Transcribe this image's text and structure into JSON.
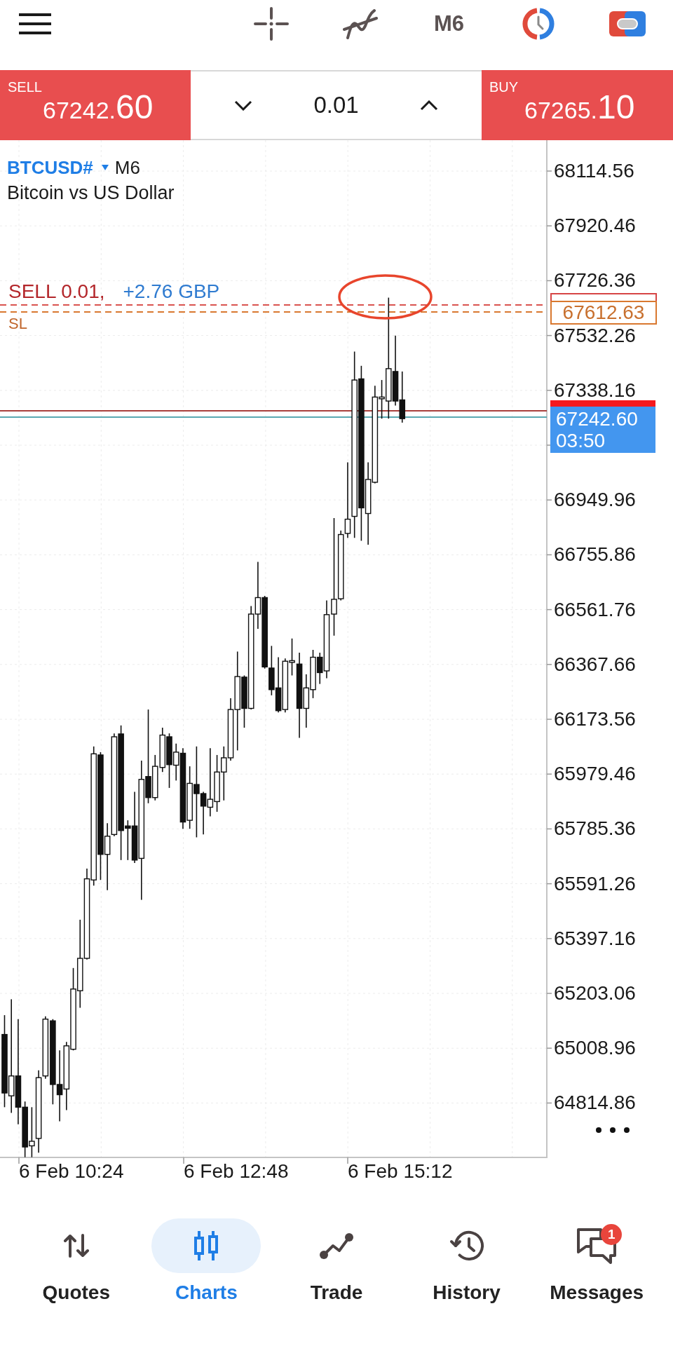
{
  "toolbar": {
    "timeframe": "M6"
  },
  "trade_panel": {
    "sell": {
      "label": "SELL",
      "price_head": "67242.",
      "price_tail": "60"
    },
    "volume": "0.01",
    "buy": {
      "label": "BUY",
      "price_head": "67265.",
      "price_tail": "10"
    }
  },
  "chart": {
    "symbol": "BTCUSD#",
    "timeframe": "M6",
    "description": "Bitcoin vs US Dollar",
    "position": {
      "label": "SELL 0.01,",
      "profit": "+2.76 GBP"
    },
    "stop_loss_label": "SL",
    "stop_loss_price": "67612.63",
    "bid_price": "67242.60",
    "bar_countdown": "03:50",
    "price_axis": [
      "68114.56",
      "67920.46",
      "67726.36",
      "67532.26",
      "67338.16",
      "66949.96",
      "66755.86",
      "66561.76",
      "66367.66",
      "66173.56",
      "65979.46",
      "65785.36",
      "65591.26",
      "65397.16",
      "65203.06",
      "65008.96",
      "64814.86"
    ],
    "time_axis": [
      "6 Feb 10:24",
      "6 Feb 12:48",
      "6 Feb 15:12"
    ]
  },
  "bottom_nav": [
    {
      "label": "Quotes",
      "selected": false
    },
    {
      "label": "Charts",
      "selected": true
    },
    {
      "label": "Trade",
      "selected": false
    },
    {
      "label": "History",
      "selected": false
    },
    {
      "label": "Messages",
      "selected": false,
      "badge": "1"
    }
  ]
}
